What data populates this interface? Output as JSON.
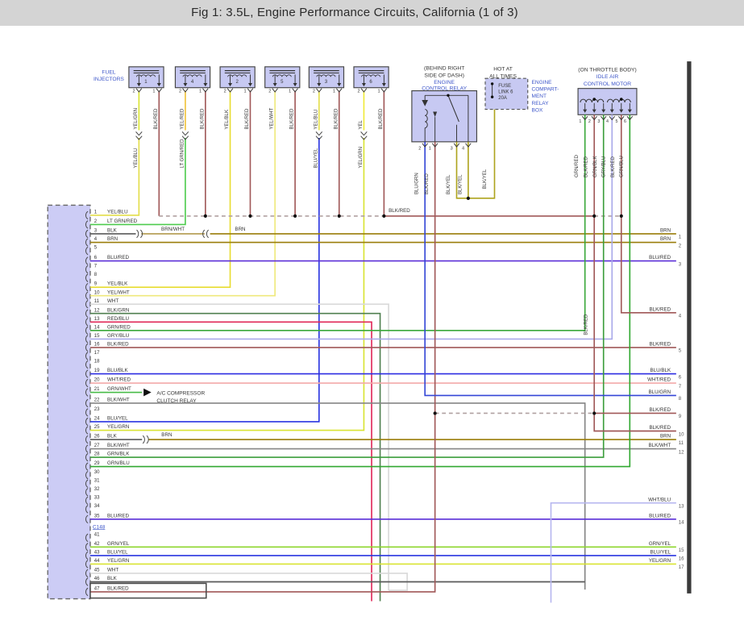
{
  "title": "Fig 1: 3.5L, Engine Performance Circuits, California (1 of 3)",
  "palette": {
    "title_bar_bg": "#d4d4d4",
    "component_fill": "#c7c9f2",
    "connector_fill": "#ccccf5",
    "label_blue": "#3d56c9",
    "text_dark": "#333333",
    "border_dark": "#4a4a4a",
    "page_edge_bar": "#3a3a3a"
  },
  "wire_colors": {
    "YEL": "#f0ea38",
    "YEL/GRN": "#d9e433",
    "YEL/RED": "#f0c23a",
    "YEL/BLK": "#e8dc30",
    "YEL/WHT": "#efe97c",
    "YEL/BLU": "#e3de4a",
    "LT GRN/RED": "#4ecb4e",
    "BLK/RED": "#a05858",
    "BLU/GRN": "#3547d6",
    "BLU/RED": "#5b2fd8",
    "BLU/YEL": "#2a35e0",
    "BLU/BLK": "#2e2ee2",
    "BRN": "#9a7d0a",
    "BRN/WHT": "#b29a4d",
    "BLK": "#5a5a5a",
    "BLK/WHT": "#858585",
    "BLK/GRN": "#508050",
    "BLK/YEL": "#aea41e",
    "WHT": "#d9d9d9",
    "WHT/RED": "#f3a9a9",
    "WHT/BLU": "#b7b7ef",
    "GRN/RED": "#3aa83a",
    "GRN/BLK": "#3b9d3b",
    "GRN/BLU": "#31a831",
    "GRN/WHT": "#47bb47",
    "GRN/YEL": "#8ed62e",
    "RED/BLU": "#e02858",
    "GRY/BLU": "#a9a9e9",
    "DASH": "#b0a0a0"
  },
  "injectors": {
    "group_label_1": "FUEL",
    "group_label_2": "INJECTORS",
    "pin_left": "2",
    "pin_right": "1",
    "items": [
      {
        "num": "1",
        "top": "YEL/GRN",
        "bottom": "YEL/BLU",
        "ground": "BLK/RED"
      },
      {
        "num": "4",
        "top": "YEL/RED",
        "bottom": "LT GRN/RED",
        "ground": "BLK/RED"
      },
      {
        "num": "2",
        "top": "YEL/BLK",
        "bottom": "",
        "ground": "BLK/RED"
      },
      {
        "num": "5",
        "top": "YEL/WHT",
        "bottom": "",
        "ground": "BLK/RED"
      },
      {
        "num": "3",
        "top": "YEL/BLU",
        "bottom": "BLU/YEL",
        "ground": "BLK/RED"
      },
      {
        "num": "6",
        "top": "YEL",
        "bottom": "YEL/GRN",
        "ground": "BLK/RED"
      }
    ]
  },
  "relay": {
    "location_1": "(BEHIND RIGHT",
    "location_2": "SIDE OF DASH)",
    "name_1": "ENGINE",
    "name_2": "CONTROL RELAY",
    "pins": [
      "2",
      "1",
      "3",
      "4"
    ],
    "pin_wires": [
      "BLU/GRN",
      "BLK/RED",
      "BLK/YEL",
      "BLK/YEL"
    ]
  },
  "fuse": {
    "hot_1": "HOT AT",
    "hot_2": "ALL TIMES",
    "label_1": "FUSE",
    "label_2": "LINK 6",
    "label_3": "20A",
    "box_name": [
      "ENGINE",
      "COMPART-",
      "MENT",
      "RELAY",
      "BOX"
    ],
    "wire": "BLK/YEL"
  },
  "iac": {
    "location": "(ON THROTTLE BODY)",
    "name_1": "IDLE AIR",
    "name_2": "CONTROL MOTOR",
    "pins": [
      "1",
      "2",
      "3",
      "4",
      "5",
      "6"
    ],
    "pin_wires": [
      "GRN/RED",
      "BLK/RED",
      "GRN/BLK",
      "GRY/BLU",
      "BLK/RED",
      "GRN/BLU"
    ],
    "mid_wire_label": "BLK/RED"
  },
  "bus_label": "BLK/RED",
  "splice_row3": {
    "mid": "BRN/WHT",
    "right": "BRN"
  },
  "splice_row26": {
    "right": "BRN"
  },
  "ac_relay": {
    "line1": "A/C COMPRESSOR",
    "line2": "CLUTCH RELAY"
  },
  "connector": {
    "divider": "C148",
    "rows": [
      {
        "n": "1",
        "label": "YEL/BLU"
      },
      {
        "n": "2",
        "label": "LT GRN/RED"
      },
      {
        "n": "3",
        "label": "BLK"
      },
      {
        "n": "4",
        "label": "BRN"
      },
      {
        "n": "5",
        "label": ""
      },
      {
        "n": "6",
        "label": "BLU/RED"
      },
      {
        "n": "7",
        "label": ""
      },
      {
        "n": "8",
        "label": ""
      },
      {
        "n": "9",
        "label": "YEL/BLK"
      },
      {
        "n": "10",
        "label": "YEL/WHT"
      },
      {
        "n": "11",
        "label": "WHT"
      },
      {
        "n": "12",
        "label": "BLK/GRN"
      },
      {
        "n": "13",
        "label": "RED/BLU"
      },
      {
        "n": "14",
        "label": "GRN/RED"
      },
      {
        "n": "15",
        "label": "GRY/BLU"
      },
      {
        "n": "16",
        "label": "BLK/RED"
      },
      {
        "n": "17",
        "label": ""
      },
      {
        "n": "18",
        "label": ""
      },
      {
        "n": "19",
        "label": "BLU/BLK"
      },
      {
        "n": "20",
        "label": "WHT/RED"
      },
      {
        "n": "21",
        "label": "GRN/WHT"
      },
      {
        "n": "22",
        "label": "BLK/WHT"
      },
      {
        "n": "23",
        "label": ""
      },
      {
        "n": "24",
        "label": "BLU/YEL"
      },
      {
        "n": "25",
        "label": "YEL/GRN"
      },
      {
        "n": "26",
        "label": "BLK"
      },
      {
        "n": "27",
        "label": "BLK/WHT"
      },
      {
        "n": "28",
        "label": "GRN/BLK"
      },
      {
        "n": "29",
        "label": "GRN/BLU"
      },
      {
        "n": "30",
        "label": ""
      },
      {
        "n": "31",
        "label": ""
      },
      {
        "n": "32",
        "label": ""
      },
      {
        "n": "33",
        "label": ""
      },
      {
        "n": "34",
        "label": ""
      },
      {
        "n": "35",
        "label": "BLU/RED"
      }
    ],
    "rows2": [
      {
        "n": "41",
        "label": ""
      },
      {
        "n": "42",
        "label": "GRN/YEL"
      },
      {
        "n": "43",
        "label": "BLU/YEL"
      },
      {
        "n": "44",
        "label": "YEL/GRN"
      },
      {
        "n": "45",
        "label": "WHT"
      },
      {
        "n": "46",
        "label": "BLK"
      },
      {
        "n": "47",
        "label": "BLK/RED"
      }
    ]
  },
  "right_labels": [
    {
      "n": "1",
      "label": "BRN"
    },
    {
      "n": "2",
      "label": "BRN"
    },
    {
      "n": "3",
      "label": "BLU/RED"
    },
    {
      "n": "4",
      "label": "BLK/RED"
    },
    {
      "n": "5",
      "label": "BLK/RED"
    },
    {
      "n": "6",
      "label": "BLU/BLK"
    },
    {
      "n": "7",
      "label": "WHT/RED"
    },
    {
      "n": "8",
      "label": "BLU/GRN"
    },
    {
      "n": "9",
      "label": "BLK/RED"
    },
    {
      "n": "10",
      "label": "BLK/RED"
    },
    {
      "n": "11",
      "label": "BRN"
    },
    {
      "n": "12",
      "label": "BLK/WHT"
    },
    {
      "n": "13",
      "label": "WHT/BLU"
    },
    {
      "n": "14",
      "label": "BLU/RED"
    },
    {
      "n": "15",
      "label": "GRN/YEL"
    },
    {
      "n": "16",
      "label": "BLU/YEL"
    },
    {
      "n": "17",
      "label": "YEL/GRN"
    }
  ]
}
